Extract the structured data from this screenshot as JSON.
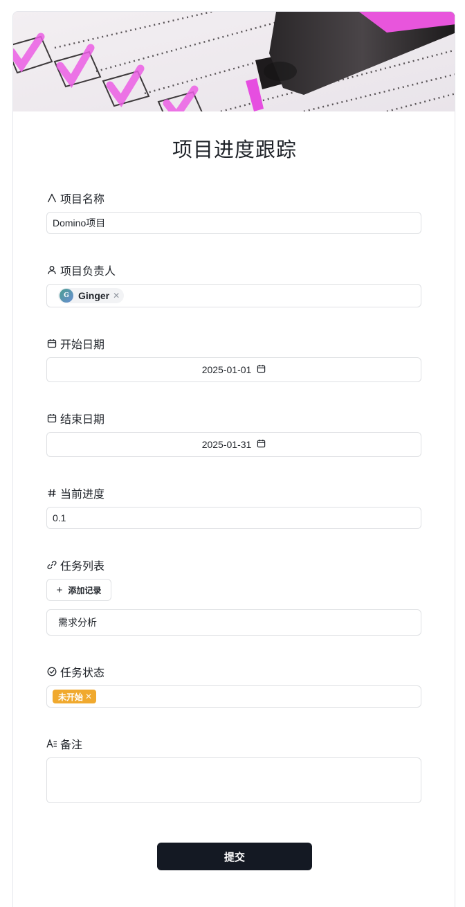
{
  "form": {
    "title": "项目进度跟踪",
    "submit_label": "提交"
  },
  "fields": {
    "project_name": {
      "label": "项目名称",
      "value": "Domino项目",
      "icon": "text-icon"
    },
    "owner": {
      "label": "项目负责人",
      "person": "Ginger",
      "avatar_initial": "G",
      "icon": "person-icon"
    },
    "start_date": {
      "label": "开始日期",
      "value": "2025-01-01",
      "icon": "calendar-icon"
    },
    "end_date": {
      "label": "结束日期",
      "value": "2025-01-31",
      "icon": "calendar-icon"
    },
    "progress": {
      "label": "当前进度",
      "value": "0.1",
      "icon": "hash-icon"
    },
    "task_list": {
      "label": "任务列表",
      "add_label": "添加记录",
      "records": [
        "需求分析"
      ],
      "icon": "link-icon"
    },
    "task_status": {
      "label": "任务状态",
      "value": "未开始",
      "color": "#f0a92e",
      "icon": "check-circle-icon"
    },
    "notes": {
      "label": "备注",
      "value": "",
      "icon": "rich-text-icon"
    }
  },
  "colors": {
    "submit_bg": "#141923",
    "border": "#dee0e3",
    "highlighter": "#e64ee0"
  }
}
